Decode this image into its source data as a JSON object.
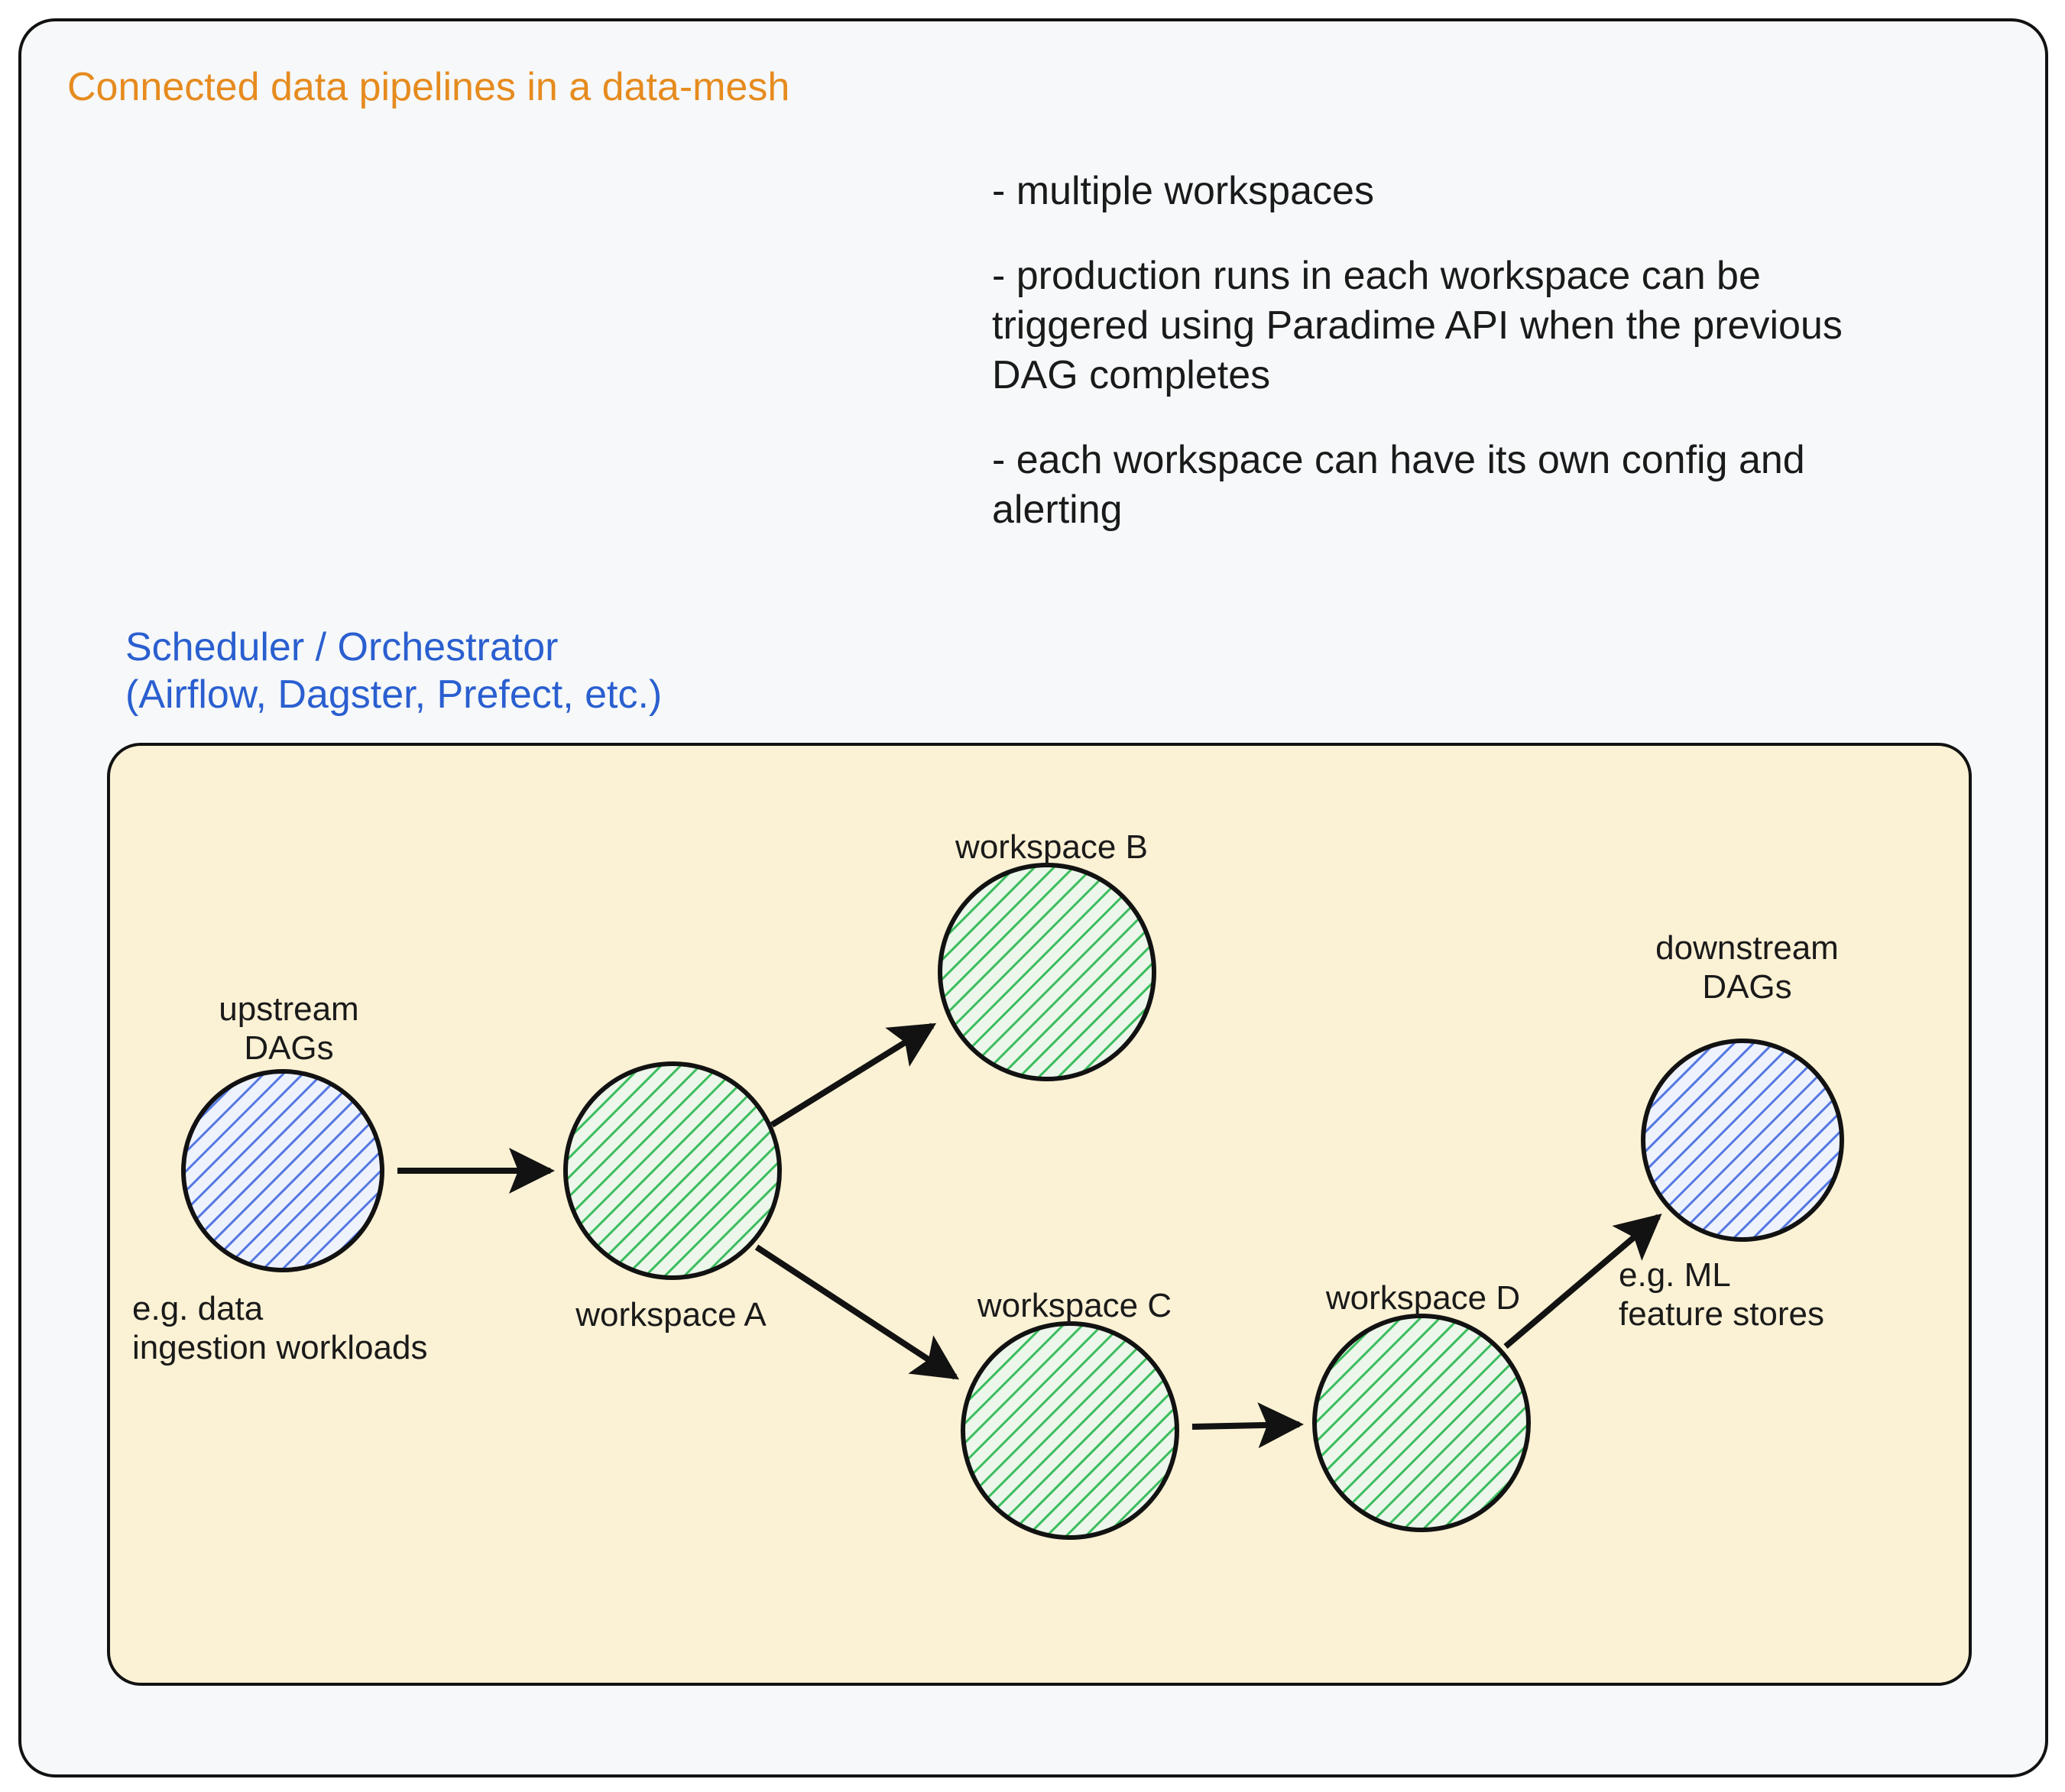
{
  "title": "Connected data pipelines in a data-mesh",
  "bullets": {
    "b1": "- multiple workspaces",
    "b2": "- production runs in each workspace can be triggered using Paradime API when the previous DAG completes",
    "b3": "- each workspace can have its own config and alerting"
  },
  "scheduler": {
    "title_line1": "Scheduler / Orchestrator",
    "title_line2": "(Airflow, Dagster, Prefect, etc.)"
  },
  "nodes": {
    "upstream": {
      "label_line1": "upstream",
      "label_line2": "DAGs",
      "caption_line1": "e.g. data",
      "caption_line2": "ingestion workloads",
      "color": "#3a62d6",
      "fill": "#dde7fb"
    },
    "workspace_a": {
      "label": "workspace A",
      "color": "#2fa84f",
      "fill": "#deefdb"
    },
    "workspace_b": {
      "label": "workspace B",
      "color": "#2fa84f",
      "fill": "#deefdb"
    },
    "workspace_c": {
      "label": "workspace C",
      "color": "#2fa84f",
      "fill": "#deefdb"
    },
    "workspace_d": {
      "label": "workspace D",
      "color": "#2fa84f",
      "fill": "#deefdb"
    },
    "downstream": {
      "label_line1": "downstream",
      "label_line2": "DAGs",
      "caption_line1": "e.g. ML",
      "caption_line2": "feature stores",
      "color": "#3a62d6",
      "fill": "#dde7fb"
    }
  },
  "colors": {
    "title": "#e68b1f",
    "scheduler_label": "#2a5fd0",
    "outer_bg": "#f6f8f9",
    "box_bg": "#fbf1d4",
    "stroke": "#121212"
  }
}
